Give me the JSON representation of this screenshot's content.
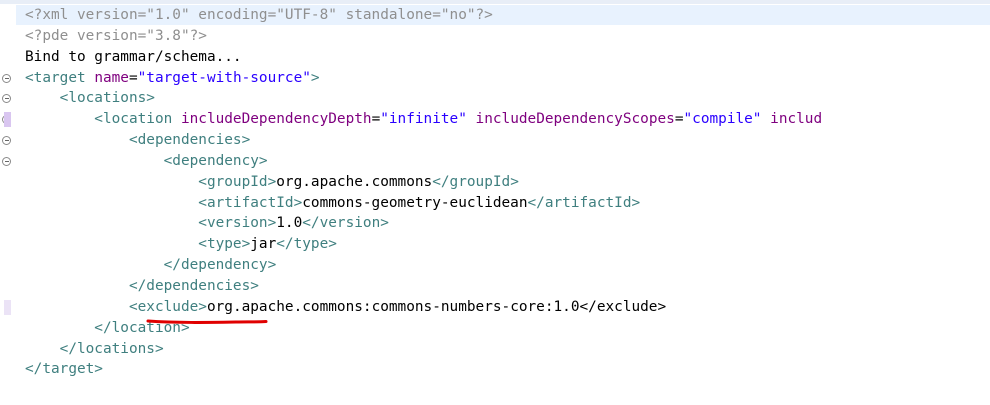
{
  "editor": {
    "lines": [
      {
        "segments": [
          {
            "text": "<?xml version=\"1.0\" encoding=\"UTF-8\" standalone=\"no\"?>",
            "style": "pi"
          }
        ]
      },
      {
        "segments": [
          {
            "text": "<?pde version=\"3.8\"?>",
            "style": "pi"
          }
        ]
      },
      {
        "segments": [
          {
            "text": "Bind to grammar/schema...",
            "style": "plain"
          }
        ]
      },
      {
        "segments": [
          {
            "text": "<target ",
            "style": "tag"
          },
          {
            "text": "name",
            "style": "attr"
          },
          {
            "text": "=",
            "style": "plain"
          },
          {
            "text": "\"target-with-source\"",
            "style": "val"
          },
          {
            "text": ">",
            "style": "tag"
          }
        ]
      },
      {
        "segments": [
          {
            "text": "    <locations>",
            "style": "tag"
          }
        ]
      },
      {
        "segments": [
          {
            "text": "        <location ",
            "style": "tag"
          },
          {
            "text": "includeDependencyDepth",
            "style": "attr"
          },
          {
            "text": "=",
            "style": "plain"
          },
          {
            "text": "\"infinite\"",
            "style": "val"
          },
          {
            "text": " ",
            "style": "plain"
          },
          {
            "text": "includeDependencyScopes",
            "style": "attr"
          },
          {
            "text": "=",
            "style": "plain"
          },
          {
            "text": "\"compile\"",
            "style": "val"
          },
          {
            "text": " ",
            "style": "plain"
          },
          {
            "text": "includ",
            "style": "attr"
          }
        ]
      },
      {
        "segments": [
          {
            "text": "            <dependencies>",
            "style": "tag"
          }
        ]
      },
      {
        "segments": [
          {
            "text": "                <dependency>",
            "style": "tag"
          }
        ]
      },
      {
        "segments": [
          {
            "text": "                    <groupId>",
            "style": "tag"
          },
          {
            "text": "org.apache.commons",
            "style": "plain"
          },
          {
            "text": "</groupId>",
            "style": "tag"
          }
        ]
      },
      {
        "segments": [
          {
            "text": "                    <artifactId>",
            "style": "tag"
          },
          {
            "text": "commons-geometry-euclidean",
            "style": "plain"
          },
          {
            "text": "</artifactId>",
            "style": "tag"
          }
        ]
      },
      {
        "segments": [
          {
            "text": "                    <version>",
            "style": "tag"
          },
          {
            "text": "1.0",
            "style": "plain"
          },
          {
            "text": "</version>",
            "style": "tag"
          }
        ]
      },
      {
        "segments": [
          {
            "text": "                    <type>",
            "style": "tag"
          },
          {
            "text": "jar",
            "style": "plain"
          },
          {
            "text": "</type>",
            "style": "tag"
          }
        ]
      },
      {
        "segments": [
          {
            "text": "                </dependency>",
            "style": "tag"
          }
        ]
      },
      {
        "segments": [
          {
            "text": "            </dependencies>",
            "style": "tag"
          }
        ]
      },
      {
        "segments": [
          {
            "text": "            <exclude>",
            "style": "tag"
          },
          {
            "text": "org.apache.commons:commons-numbers-core:1.0</exclude>",
            "style": "plain"
          }
        ]
      },
      {
        "segments": [
          {
            "text": "        </location>",
            "style": "tag"
          }
        ]
      },
      {
        "segments": [
          {
            "text": "    </locations>",
            "style": "tag"
          }
        ]
      },
      {
        "segments": [
          {
            "text": "</target>",
            "style": "tag"
          }
        ]
      }
    ],
    "gutter": [
      {
        "line": 4,
        "type": "fold"
      },
      {
        "line": 5,
        "type": "fold"
      },
      {
        "line": 6,
        "type": "fold"
      },
      {
        "line": 6,
        "type": "mark"
      },
      {
        "line": 7,
        "type": "fold"
      },
      {
        "line": 8,
        "type": "fold"
      },
      {
        "line": 15,
        "type": "mark-light"
      }
    ],
    "annotation": {
      "name": "red-underline-exclude",
      "color": "#e00000",
      "target_line": 15
    },
    "colors": {
      "tag": "#3f7f7f",
      "attribute": "#7f007f",
      "value": "#2a00ff",
      "text": "#000000",
      "processing_instruction": "#8f8f8f",
      "current_line": "#e8f2fe"
    }
  }
}
